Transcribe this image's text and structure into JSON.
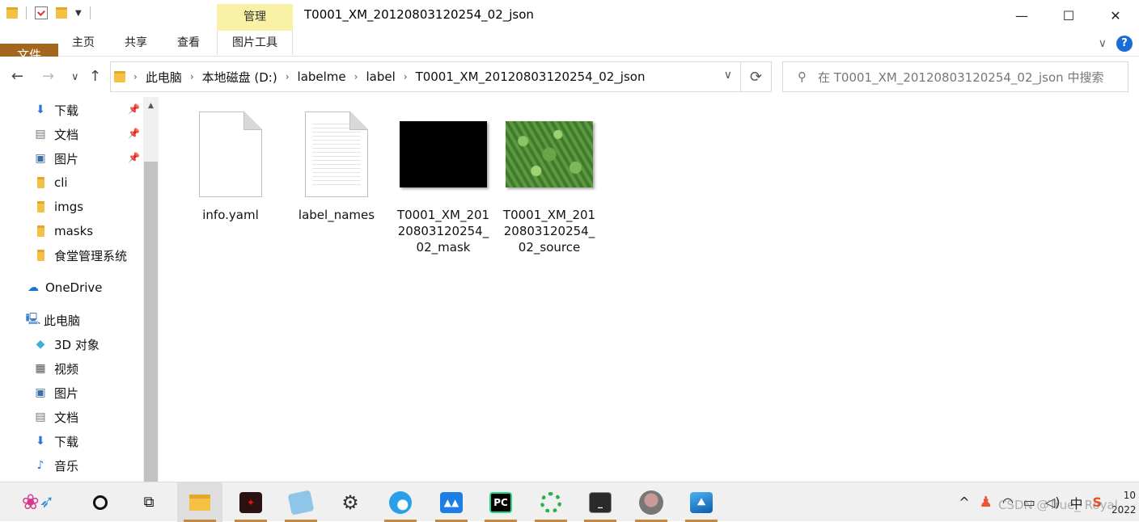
{
  "window": {
    "title": "T0001_XM_20120803120254_02_json",
    "context_tab": "管理",
    "controls": {
      "minimize": "—",
      "maximize": "☐",
      "close": "✕"
    }
  },
  "ribbon": {
    "tabs": [
      "文件",
      "主页",
      "共享",
      "查看",
      "图片工具"
    ],
    "expand": "∨",
    "help": "?"
  },
  "nav": {
    "back": "←",
    "forward": "→",
    "recent": "∨",
    "up": "↑"
  },
  "address": {
    "crumbs": [
      "此电脑",
      "本地磁盘 (D:)",
      "labelme",
      "label",
      "T0001_XM_20120803120254_02_json"
    ],
    "refresh": "⟳"
  },
  "search": {
    "placeholder": "在 T0001_XM_20120803120254_02_json 中搜索"
  },
  "sidebar": {
    "quick_access": [
      {
        "label": "下载",
        "icon": "download-arrow-icon",
        "pinned": true
      },
      {
        "label": "文档",
        "icon": "document-icon",
        "pinned": true
      },
      {
        "label": "图片",
        "icon": "picture-icon",
        "pinned": true
      },
      {
        "label": "cli",
        "icon": "folder-icon",
        "pinned": false
      },
      {
        "label": "imgs",
        "icon": "folder-icon",
        "pinned": false
      },
      {
        "label": "masks",
        "icon": "folder-icon",
        "pinned": false
      },
      {
        "label": "食堂管理系统",
        "icon": "folder-icon",
        "pinned": false
      }
    ],
    "onedrive": "OneDrive",
    "this_pc": "此电脑",
    "pc_items": [
      {
        "label": "3D 对象",
        "icon": "cube-icon"
      },
      {
        "label": "视频",
        "icon": "film-icon"
      },
      {
        "label": "图片",
        "icon": "picture-icon"
      },
      {
        "label": "文档",
        "icon": "document-icon"
      },
      {
        "label": "下载",
        "icon": "download-arrow-icon"
      },
      {
        "label": "音乐",
        "icon": "music-note-icon"
      }
    ]
  },
  "files": [
    {
      "name": "info.yaml",
      "type": "blank-document"
    },
    {
      "name": "label_names",
      "type": "text-document"
    },
    {
      "name": "T0001_XM_20120803120254_02_mask",
      "type": "black-image"
    },
    {
      "name": "T0001_XM_20120803120254_02_source",
      "type": "grass-photo"
    }
  ],
  "taskbar": {
    "apps": [
      "cortana-circle-icon",
      "task-view-icon",
      "file-explorer-icon",
      "game-app-icon",
      "notepad-icon",
      "settings-gear-icon",
      "edge-browser-icon",
      "lanhu-app-icon",
      "pycharm-icon",
      "loading-ring-icon",
      "terminal-icon",
      "avatar-app-icon",
      "photos-app-icon"
    ],
    "pycharm_label": "PC",
    "tray": {
      "chevron": "^",
      "ime": "中",
      "clock_time": "10",
      "clock_date": "2022"
    }
  },
  "watermark": "CSDN @True_ Royal",
  "colors": {
    "file_tab": "#a4661e",
    "manage_tab": "#f9f1a5",
    "accent": "#1a6dd6"
  }
}
